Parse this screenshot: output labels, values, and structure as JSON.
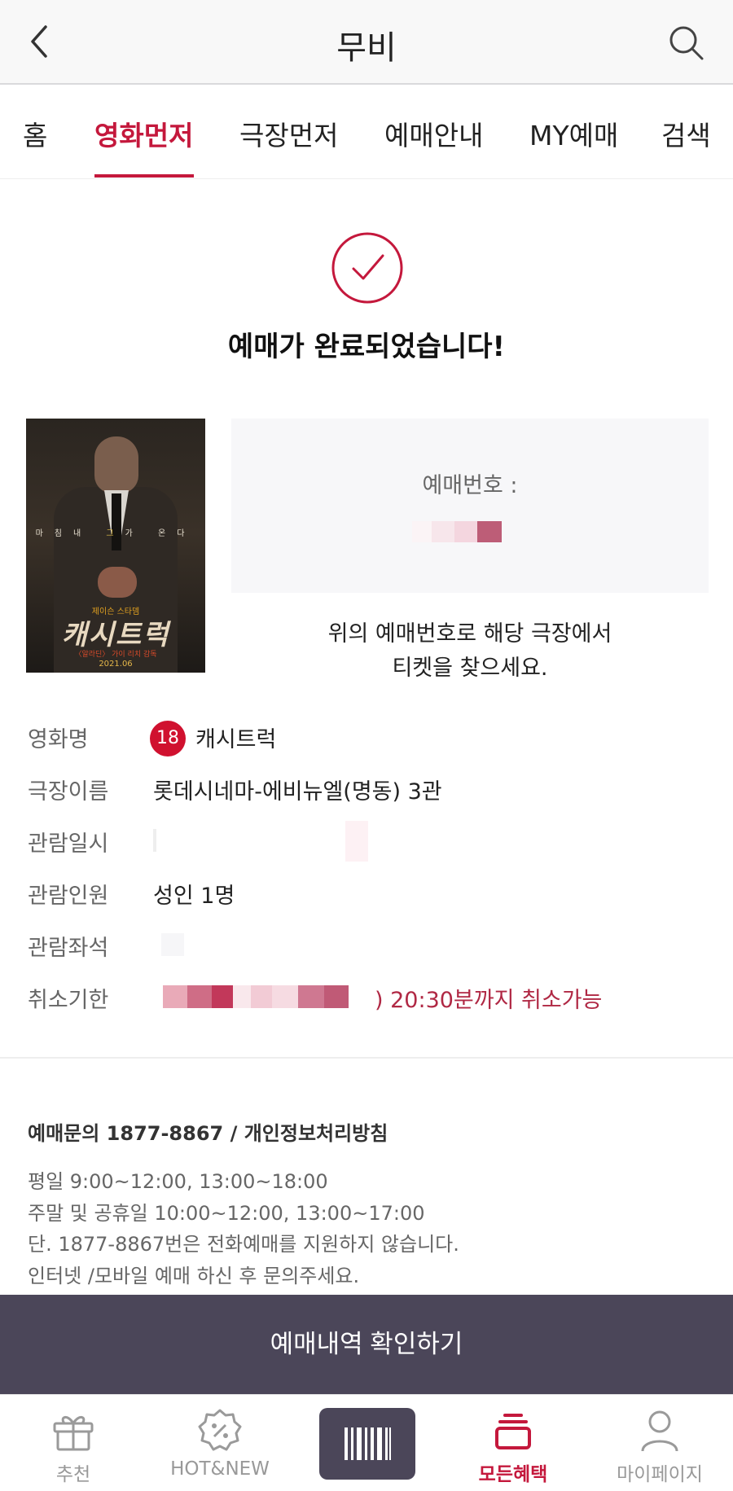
{
  "header": {
    "title": "무비"
  },
  "tabs": [
    {
      "label": "홈"
    },
    {
      "label": "영화먼저",
      "active": true
    },
    {
      "label": "극장먼저"
    },
    {
      "label": "예매안내"
    },
    {
      "label": "MY예매"
    },
    {
      "label": "검색"
    }
  ],
  "confirmation": {
    "title": "예매가 완료되었습니다!",
    "booking_label": "예매번호 :",
    "find_msg_line1": "위의 예매번호로 해당 극장에서",
    "find_msg_line2": "티켓을 찾으세요."
  },
  "poster": {
    "tagline_a": "마침내",
    "tagline_hl": "그",
    "tagline_b": "가 온다",
    "credit": "제이슨 스타뎀",
    "title": "캐시트럭",
    "sub": "〈알라딘〉 가이 리치 감독",
    "date": "2021.06"
  },
  "details": {
    "movie_label": "영화명",
    "age_rating": "18",
    "movie_title": "캐시트럭",
    "theater_label": "극장이름",
    "theater_value": "롯데시네마-에비뉴엘(명동) 3관",
    "datetime_label": "관람일시",
    "audience_label": "관람인원",
    "audience_value": "성인 1명",
    "seat_label": "관람좌석",
    "cancel_label": "취소기한",
    "cancel_value": ") 20:30분까지 취소가능"
  },
  "info": {
    "title": "예매문의 1877-8867 / 개인정보처리방침",
    "line1": "평일 9:00~12:00, 13:00~18:00",
    "line2": "주말 및 공휴일 10:00~12:00, 13:00~17:00",
    "line3": "단. 1877-8867번은 전화예매를 지원하지 않습니다.",
    "line4": "인터넷 /모바일 예매 하신 후 문의주세요."
  },
  "cta": {
    "label": "예매내역 확인하기"
  },
  "bottom_nav": [
    {
      "label": "추천",
      "icon": "gift-icon"
    },
    {
      "label": "HOT&NEW",
      "icon": "percent-badge-icon"
    },
    {
      "label": "",
      "icon": "barcode-icon"
    },
    {
      "label": "모든혜택",
      "icon": "benefit-icon",
      "active": true
    },
    {
      "label": "마이페이지",
      "icon": "person-icon"
    }
  ],
  "colors": {
    "accent": "#c4183c",
    "header_bg": "#f8f8f8",
    "cta_bg": "#4b4659",
    "age_badge": "#d0112f"
  }
}
